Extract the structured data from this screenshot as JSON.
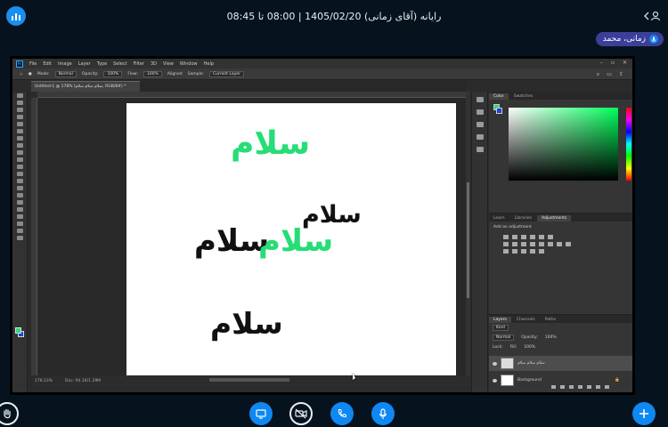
{
  "meeting": {
    "title": "رایانه (آقای زمانی) 1405/02/20 | 08:00 تا 08:45",
    "presenter_name": "زمانی، محمد"
  },
  "icons": {
    "app_logo": "bars-logo-icon",
    "users": "user-icon",
    "presenter_mic": "microphone-icon",
    "raise_hand": "hand-icon",
    "screen_share": "desktop-icon",
    "camera": "video-off-icon",
    "phone": "phone-icon",
    "mic": "microphone-icon",
    "actions": "plus-icon"
  },
  "colors": {
    "accent_blue": "#0f88f2",
    "badge_purple": "#3b3f99",
    "app_background": "#06131f",
    "ps_green": "#26dd76",
    "ps_blue": "#1e40e0"
  },
  "photoshop": {
    "menu": [
      "File",
      "Edit",
      "Image",
      "Layer",
      "Type",
      "Select",
      "Filter",
      "3D",
      "View",
      "Window",
      "Help"
    ],
    "options": {
      "mode_label": "Mode:",
      "mode_value": "Normal",
      "opacity_label": "Opacity:",
      "opacity_value": "100%",
      "flow_label": "Flow:",
      "flow_value": "100%",
      "aligned": "Aligned",
      "sample_label": "Sample:",
      "sample_value": "Current Layer"
    },
    "document_tab": "Untitled-1 @ 178% (سلام سلام سلام, RGB/8#) *",
    "canvas_words": [
      {
        "text": "سلام",
        "color": "#26dd76"
      },
      {
        "text": "سلام",
        "color": "#111111"
      },
      {
        "text": "سلام",
        "color": "#111111"
      },
      {
        "text": "سلام",
        "color": "#26dd76"
      },
      {
        "text": "سلام",
        "color": "#111111"
      }
    ],
    "status": {
      "zoom": "178.23%",
      "doc": "Doc: 94.1K/1.29M"
    },
    "color_panel_tabs": [
      "Color",
      "Swatches"
    ],
    "adjust_panel_tabs": [
      "Learn",
      "Libraries",
      "Adjustments"
    ],
    "adjust_title": "Add an adjustment",
    "layers_panel_tabs": [
      "Layers",
      "Channels",
      "Paths"
    ],
    "layers_kind": "Kind",
    "blend_mode": "Normal",
    "opacity_label": "Opacity:",
    "opacity_value": "100%",
    "lock_label": "Lock:",
    "fill_label": "Fill:",
    "fill_value": "100%",
    "layers": [
      {
        "name": "سلام سلام سلام",
        "selected": true
      },
      {
        "name": "Background",
        "selected": false
      }
    ]
  }
}
